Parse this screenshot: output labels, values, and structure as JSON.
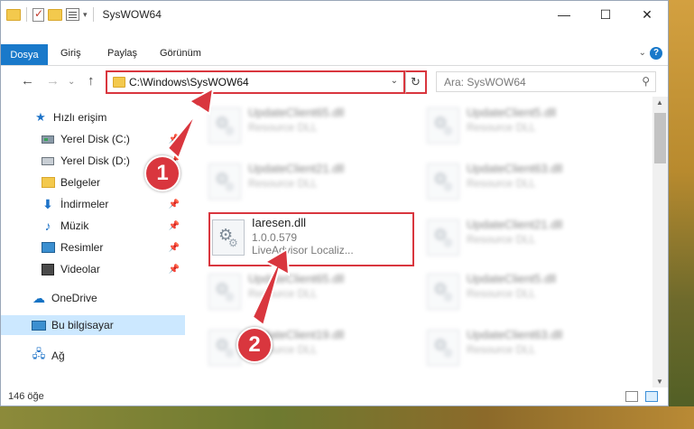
{
  "window": {
    "title": "SysWOW64",
    "controls": {
      "minimize": "—",
      "maximize": "☐",
      "close": "✕"
    }
  },
  "ribbon": {
    "tabs": [
      "Dosya",
      "Giriş",
      "Paylaş",
      "Görünüm"
    ],
    "active_color": "#1979ca",
    "help": "?"
  },
  "navigation": {
    "back": "←",
    "forward": "→",
    "up": "↑",
    "address": "C:\\Windows\\SysWOW64",
    "refresh": "↻",
    "search_placeholder": "Ara: SysWOW64"
  },
  "sidebar": {
    "items": [
      {
        "label": "Hızlı erişim",
        "icon": "star-icon"
      },
      {
        "label": "Yerel Disk (C:)",
        "icon": "disk-icon",
        "pinned": true
      },
      {
        "label": "Yerel Disk (D:)",
        "icon": "disk-icon",
        "pinned": true
      },
      {
        "label": "Belgeler",
        "icon": "folder-icon",
        "pinned": true
      },
      {
        "label": "İndirmeler",
        "icon": "download-icon",
        "pinned": true
      },
      {
        "label": "Müzik",
        "icon": "music-icon",
        "pinned": true
      },
      {
        "label": "Resimler",
        "icon": "pictures-icon",
        "pinned": true
      },
      {
        "label": "Videolar",
        "icon": "videos-icon",
        "pinned": true
      },
      {
        "label": "OneDrive",
        "icon": "cloud-icon"
      },
      {
        "label": "Bu bilgisayar",
        "icon": "computer-icon",
        "selected": true
      },
      {
        "label": "Ağ",
        "icon": "network-icon"
      }
    ]
  },
  "files": [
    {
      "name": "UpdateClient65.dll",
      "meta": "Resource DLL",
      "blurred": true
    },
    {
      "name": "UpdateClient5.dll",
      "meta": "Resource DLL",
      "blurred": true
    },
    {
      "name": "UpdateClient21.dll",
      "meta": "Resource DLL",
      "blurred": true
    },
    {
      "name": "UpdateClient63.dll",
      "meta": "Resource DLL",
      "blurred": true
    },
    {
      "name": "Iaresen.dll",
      "version": "1.0.0.579",
      "meta": "LiveAdvisor Localiz...",
      "blurred": false
    },
    {
      "name": "UpdateClient21.dll",
      "meta": "Resource DLL",
      "blurred": true
    },
    {
      "name": "UpdateClient65.dll",
      "meta": "Resource DLL",
      "blurred": true
    },
    {
      "name": "UpdateClient5.dll",
      "meta": "Resource DLL",
      "blurred": true
    },
    {
      "name": "UpdateClient19.dll",
      "meta": "Resource DLL",
      "blurred": true
    },
    {
      "name": "UpdateClient63.dll",
      "meta": "Resource DLL",
      "blurred": true
    }
  ],
  "status": {
    "item_count": "146 öğe"
  },
  "annotations": {
    "marker1": "1",
    "marker2": "2",
    "color": "#d9363e"
  }
}
